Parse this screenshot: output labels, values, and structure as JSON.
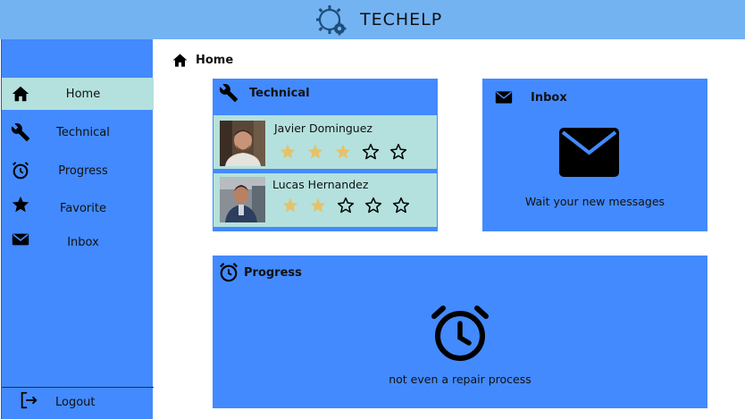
{
  "app": {
    "title": "TECHELP",
    "logo": "gear-logo-icon"
  },
  "colors": {
    "header": "#74b3f2",
    "primary": "#438afe",
    "accent_row": "#b4e1dd",
    "star_filled": "#e5c26a"
  },
  "sidebar": {
    "items": [
      {
        "label": "Home",
        "icon": "home-icon",
        "active": true
      },
      {
        "label": "Technical",
        "icon": "wrench-icon",
        "active": false
      },
      {
        "label": "Progress",
        "icon": "alarm-clock-icon",
        "active": false
      },
      {
        "label": "Favorite",
        "icon": "star-icon",
        "active": false
      },
      {
        "label": "Inbox",
        "icon": "envelope-icon",
        "active": false
      }
    ],
    "logout_label": "Logout"
  },
  "breadcrumb": {
    "label": "Home",
    "icon": "home-icon"
  },
  "technical": {
    "title": "Technical",
    "technicians": [
      {
        "name": "Javier Dominguez",
        "rating": 3,
        "max_rating": 5
      },
      {
        "name": "Lucas Hernandez",
        "rating": 2,
        "max_rating": 5
      }
    ]
  },
  "inbox": {
    "title": "Inbox",
    "message": "Wait your new messages"
  },
  "progress": {
    "title": "Progress",
    "message": "not even a repair process"
  }
}
